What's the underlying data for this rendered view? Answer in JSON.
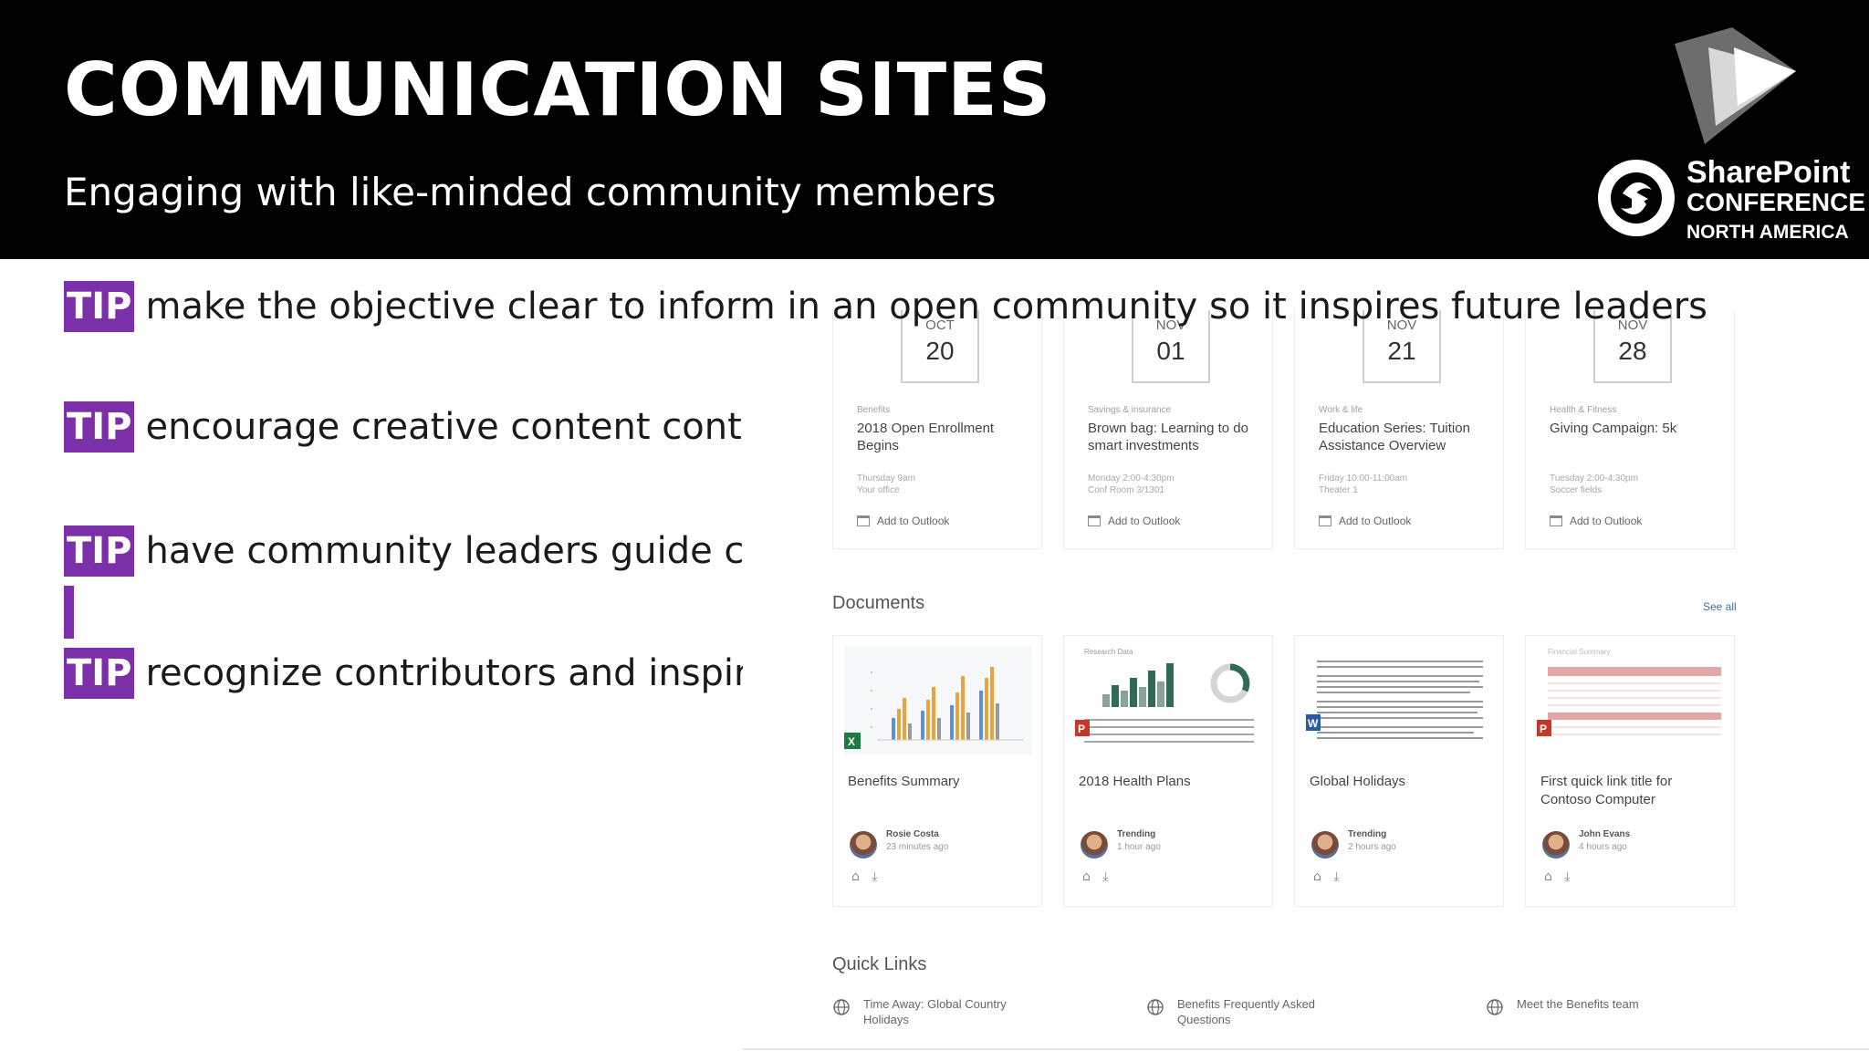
{
  "slide": {
    "title": "COMMUNICATION SITES",
    "subtitle": "Engaging with like-minded community members"
  },
  "logo": {
    "line1": "SharePoint",
    "line2": "CONFERENCE",
    "line3": "NORTH AMERICA",
    "icon": "play-icon"
  },
  "tips": [
    {
      "badge": "TIP",
      "text": "make the objective clear to inform in an open community so it inspires future leaders"
    },
    {
      "badge": "TIP",
      "text": "encourage creative content contribu"
    },
    {
      "badge": "TIP",
      "text": "have community leaders guide cont"
    },
    {
      "badge": "TIP",
      "text": "recognize contributors and inspire r"
    }
  ],
  "events": [
    {
      "month": "OCT",
      "day": "20",
      "category": "Benefits",
      "title": "2018 Open Enrollment Begins",
      "time": "Thursday 9am",
      "location": "Your office",
      "action": "Add to Outlook"
    },
    {
      "month": "NOV",
      "day": "01",
      "category": "Savings & insurance",
      "title": "Brown bag: Learning to do smart investments",
      "time": "Monday 2:00-4:30pm",
      "location": "Conf Room 3/1301",
      "action": "Add to Outlook"
    },
    {
      "month": "NOV",
      "day": "21",
      "category": "Work & life",
      "title": "Education Series: Tuition Assistance Overview",
      "time": "Friday 10:00-11:00am",
      "location": "Theater 1",
      "action": "Add to Outlook"
    },
    {
      "month": "NOV",
      "day": "28",
      "category": "Health & Fitness",
      "title": "Giving Campaign: 5k",
      "time": "Tuesday 2:00-4:30pm",
      "location": "Soccer fields",
      "action": "Add to Outlook"
    }
  ],
  "documents_section": {
    "title": "Documents",
    "see_all": "See all"
  },
  "documents": [
    {
      "thumb_label": "",
      "title": "Benefits Summary",
      "author": "Rosie Costa",
      "when": "23 minutes ago",
      "app": "excel-icon"
    },
    {
      "thumb_label": "Research Data",
      "title": "2018 Health Plans",
      "author": "Trending",
      "when": "1 hour ago",
      "app": "powerpoint-icon"
    },
    {
      "thumb_label": "",
      "title": "Global Holidays",
      "author": "Trending",
      "when": "2 hours ago",
      "app": "word-icon"
    },
    {
      "thumb_label": "Financial Summary",
      "title": "First quick link title for Contoso Computer",
      "author": "John Evans",
      "when": "4 hours ago",
      "app": "powerpoint-icon"
    }
  ],
  "quick_links": {
    "title": "Quick Links",
    "items": [
      {
        "label": "Time Away: Global Country Holidays"
      },
      {
        "label": "Benefits Frequently Asked Questions"
      },
      {
        "label": "Meet the Benefits team"
      }
    ]
  },
  "colors": {
    "header_bg": "#000000",
    "tip_badge": "#7b2fa8"
  }
}
